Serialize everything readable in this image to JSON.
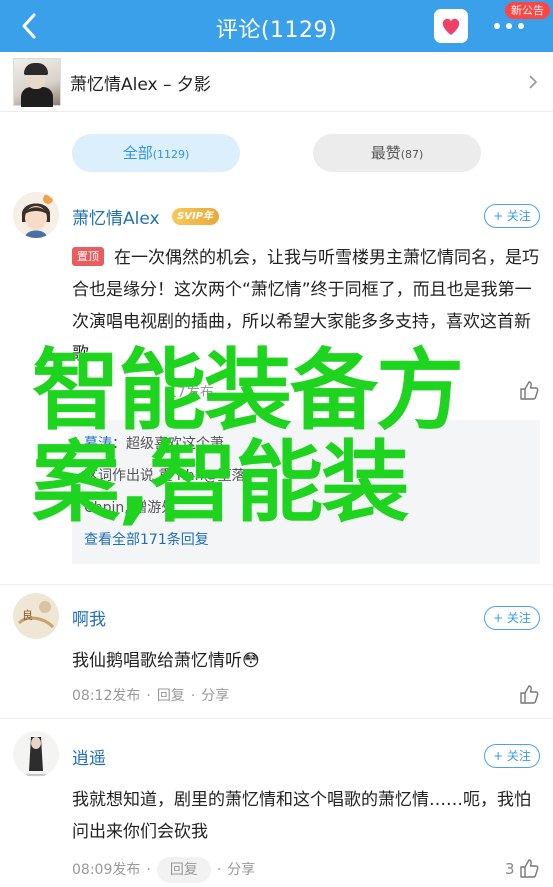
{
  "header": {
    "title": "评论(1129)",
    "badge": "新公告",
    "accent": "#3aa0ea"
  },
  "song": {
    "name": "萧忆情Alex – 夕影"
  },
  "tabs": {
    "all_label": "全部",
    "all_count": "(1129)",
    "hot_label": "最赞",
    "hot_count": "(87)"
  },
  "comments": [
    {
      "user": "萧忆情Alex",
      "vip": "SVIP",
      "vip_level": "年",
      "pinned": "置顶",
      "follow": "+ 关注",
      "text": "在一次偶然的机会，让我与听雪楼男主萧忆情同名，是巧合也是缘分！这次两个“萧忆情”终于同框了，而且也是我第一次演唱电视剧的插曲，所以希望大家能多多支持，喜欢这首新歌。",
      "meta_partial": "17发布",
      "replies_partial": [
        {
          "name": "慕涛",
          "text": "超级喜欢这个萧"
        },
        {
          "name": "",
          "text": "这词作出说   重   hhh@堕落"
        },
        {
          "name": "",
          "text": "Chpin,   赠游处…"
        }
      ],
      "replies_more": "查看全部171条回复"
    },
    {
      "user": "啊我",
      "follow": "+ 关注",
      "text": "我仙鹅唱歌给萧忆情听😳",
      "time": "08:12发布",
      "reply": "回复",
      "share": "分享",
      "likes": ""
    },
    {
      "user": "逍遥",
      "follow": "+ 关注",
      "text": "我就想知道，剧里的萧忆情和这个唱歌的萧忆情……呃，我怕问出来你们会砍我",
      "time": "08:09发布",
      "reply": "回复",
      "share": "分享",
      "likes": "3"
    }
  ],
  "overlay": {
    "text": "智能装备方案,智能装"
  }
}
